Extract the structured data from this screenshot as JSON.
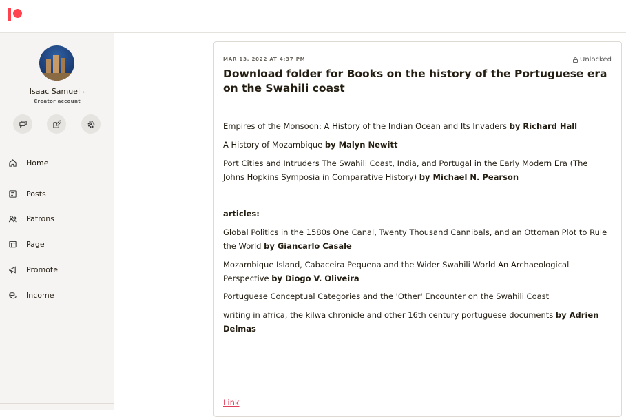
{
  "user": {
    "name": "Isaac Samuel",
    "account_type": "Creator account"
  },
  "nav": [
    {
      "label": "Home"
    },
    {
      "label": "Posts"
    },
    {
      "label": "Patrons"
    },
    {
      "label": "Page"
    },
    {
      "label": "Promote"
    },
    {
      "label": "Income"
    }
  ],
  "post": {
    "date": "MAR 13, 2022 AT 4:37 PM",
    "status": "Unlocked",
    "title": "Download folder for Books on the history of the Portuguese era on the Swahili coast",
    "books": [
      {
        "text": "Empires of the Monsoon: A History of the Indian Ocean and Its Invaders ",
        "author": "by Richard Hall"
      },
      {
        "text": "A History of Mozambique ",
        "author": "by Malyn Newitt"
      },
      {
        "text": "Port Cities and Intruders The Swahili Coast, India, and Portugal in the Early Modern Era (The Johns Hopkins Symposia in Comparative History) ",
        "author": "by Michael N. Pearson"
      }
    ],
    "articles_heading": "articles:",
    "articles": [
      {
        "text": "Global Politics in the 1580s One Canal, Twenty Thousand Cannibals, and an Ottoman Plot to Rule the World ",
        "author": "by Giancarlo Casale"
      },
      {
        "text": "Mozambique Island, Cabaceira Pequena and the Wider Swahili World An Archaeological Perspective ",
        "author": "by Diogo V. Oliveira"
      },
      {
        "text": "Portuguese Conceptual Categories and the 'Other' Encounter on the Swahili Coast",
        "author": ""
      },
      {
        "text": "writing in africa, the kilwa chronicle and other 16th century portuguese documents ",
        "author": "by Adrien Delmas"
      }
    ],
    "link_label": "Link"
  }
}
